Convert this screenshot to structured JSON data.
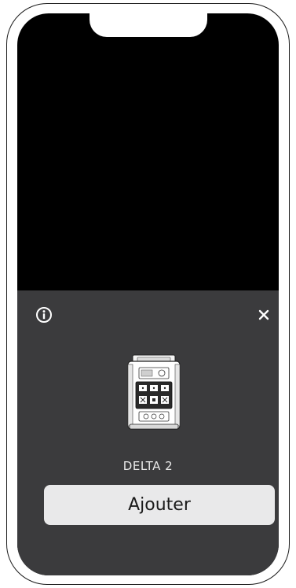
{
  "sheet": {
    "info_icon": "info-circle-icon",
    "close_icon": "close-x-icon",
    "device": {
      "image": "portable-power-station-illustration",
      "name": "DELTA 2"
    },
    "add_button": {
      "label": "Ajouter"
    }
  },
  "colors": {
    "screen_background": "#000000",
    "sheet_background": "#3b3b3d",
    "button_background": "#e9e9ea",
    "text_light": "#e8e8e8",
    "frame": "#1a1a1a"
  }
}
